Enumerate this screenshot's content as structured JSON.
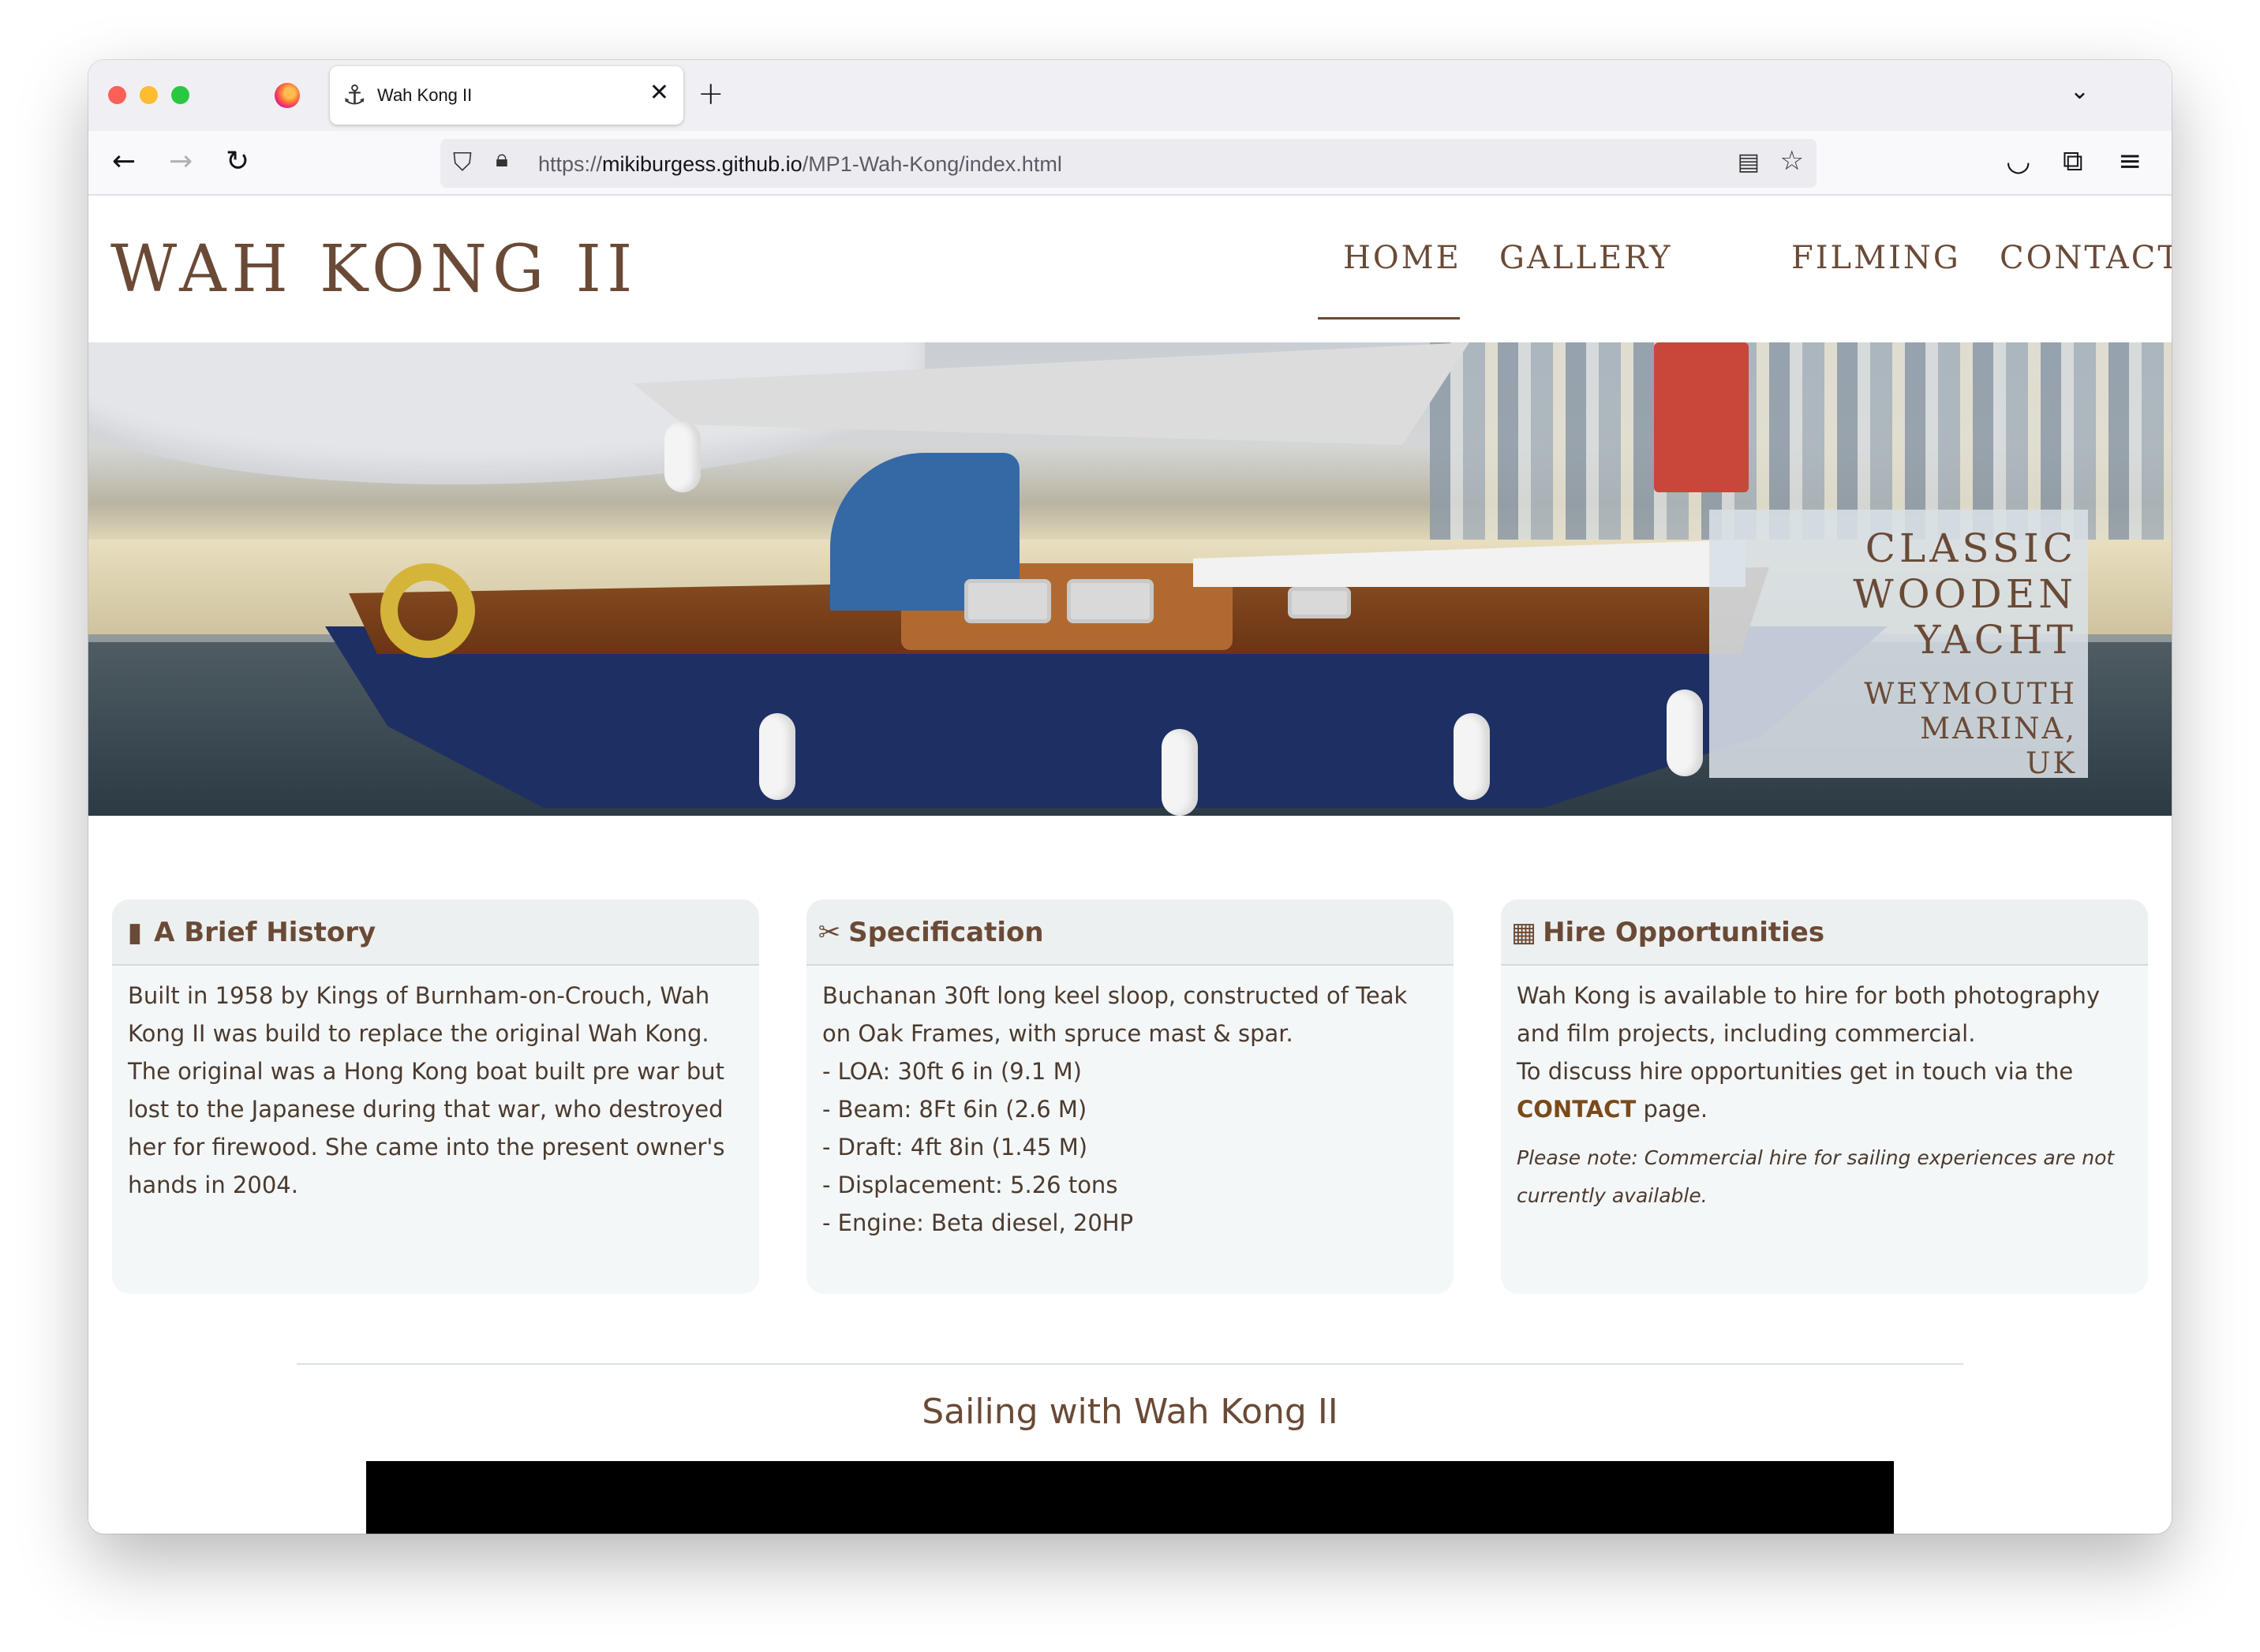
{
  "browser": {
    "tab_title": "Wah Kong II",
    "tab_icon": "anchor-icon",
    "url_prefix": "https://",
    "url_host": "mikiburgess.github.io",
    "url_path": "/MP1-Wah-Kong/index.html"
  },
  "site": {
    "brand": "WAH KONG II",
    "nav": [
      {
        "label": "HOME",
        "active": true
      },
      {
        "label": "GALLERY",
        "active": false
      },
      {
        "label": "FILMING",
        "active": false
      },
      {
        "label": "CONTACT",
        "active": false
      }
    ],
    "accent_color": "#6a4a36"
  },
  "hero": {
    "caption_title_lines": [
      "CLASSIC",
      "WOODEN",
      "YACHT"
    ],
    "caption_sub_lines": [
      "WEYMOUTH MARINA,",
      "UK"
    ]
  },
  "cards": [
    {
      "icon": "book-icon",
      "title": "A Brief History",
      "lines": [
        "Built in 1958 by Kings of Burnham-on-Crouch, Wah",
        "Kong II was build to replace the original Wah Kong.",
        "The original was a Hong Kong boat built pre war but",
        "lost to the Japanese during that war, who destroyed",
        "her for firewood. She came into the present owner's",
        "hands in 2004."
      ]
    },
    {
      "icon": "tools-icon",
      "title": "Specification",
      "lines": [
        "Buchanan 30ft long keel sloop, constructed of Teak",
        "on Oak Frames, with spruce mast & spar.",
        "- LOA: 30ft 6 in (9.1 M)",
        "- Beam: 8Ft 6in (2.6 M)",
        "- Draft: 4ft 8in (1.45 M)",
        "- Displacement: 5.26 tons",
        "- Engine: Beta diesel, 20HP"
      ]
    },
    {
      "icon": "calendar-icon",
      "title": "Hire Opportunities",
      "lines": [
        "Wah Kong is available to hire for both photography",
        "and film projects, including commercial.",
        "To discuss hire opportunities get in touch via the"
      ],
      "link_text": "CONTACT",
      "link_suffix": " page.",
      "note_lines": [
        "Please note: Commercial hire for sailing experiences are not",
        "currently available."
      ]
    }
  ],
  "section": {
    "title": "Sailing with Wah Kong II"
  }
}
